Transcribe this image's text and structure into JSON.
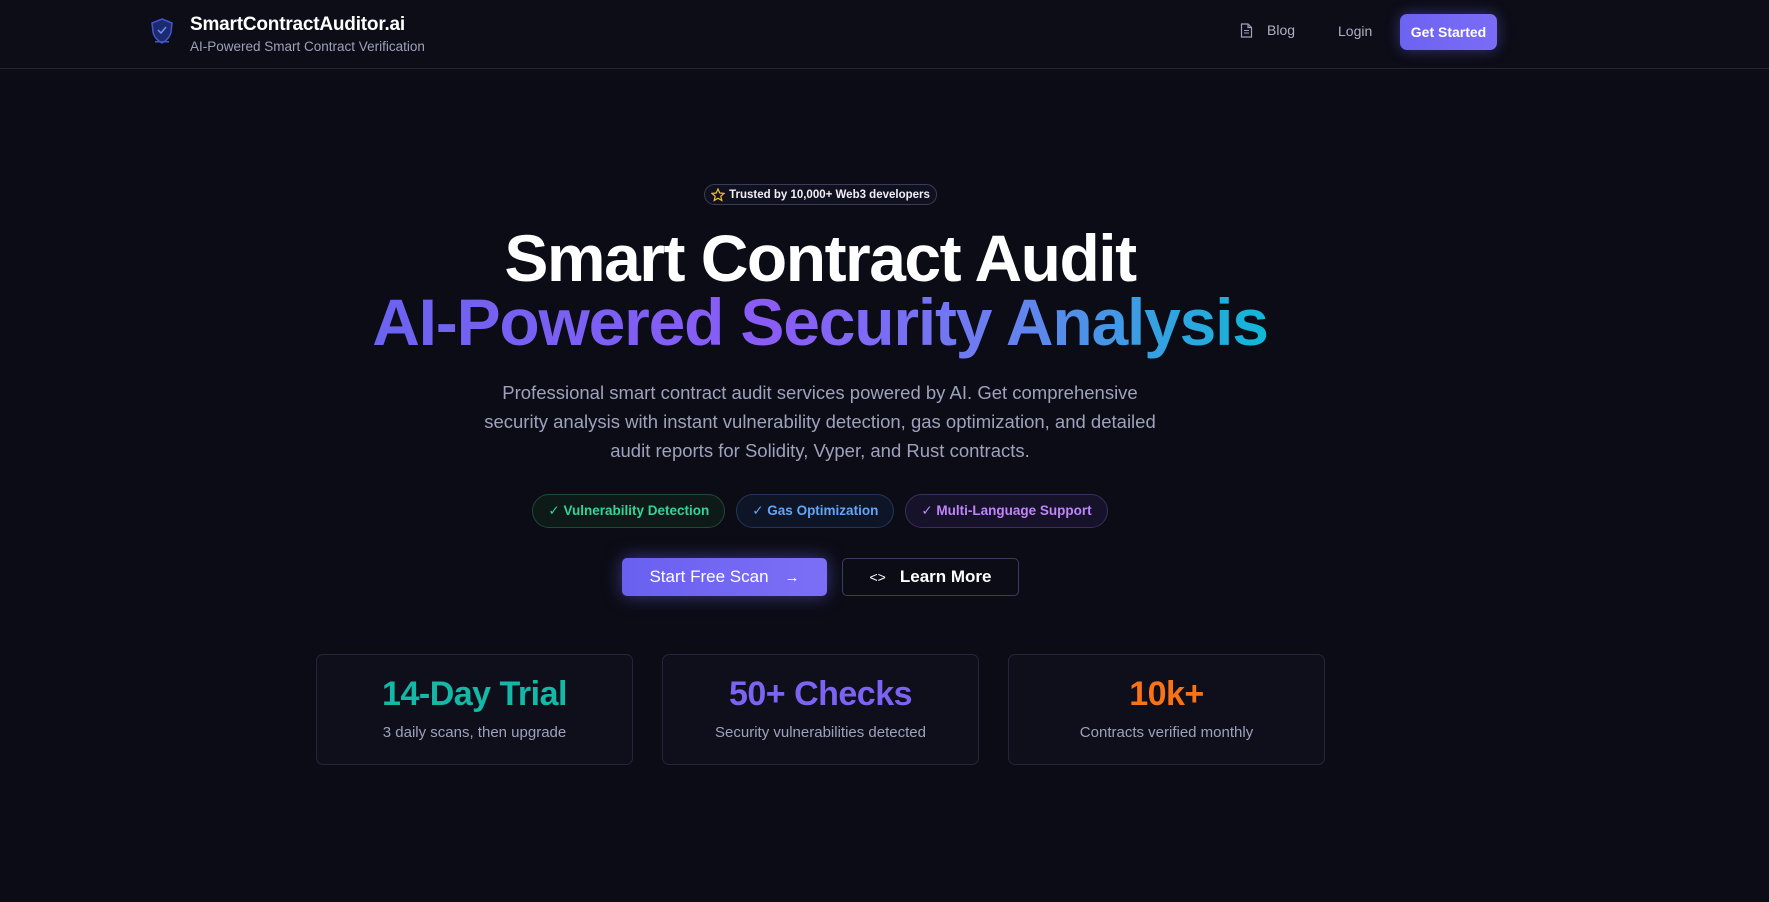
{
  "header": {
    "brand_title": "SmartContractAuditor.ai",
    "brand_subtitle": "AI-Powered Smart Contract Verification",
    "nav_blog": "Blog",
    "nav_login": "Login",
    "nav_cta": "Get Started"
  },
  "hero": {
    "badge": "Trusted by 10,000+ Web3 developers",
    "title_line1": "Smart Contract Audit",
    "title_line2": "AI-Powered Security Analysis",
    "description": "Professional smart contract audit services powered by AI. Get comprehensive security analysis with instant vulnerability detection, gas optimization, and detailed audit reports for Solidity, Vyper, and Rust contracts.",
    "features": [
      "✓ Vulnerability Detection",
      "✓ Gas Optimization",
      "✓ Multi-Language Support"
    ],
    "primary_button": "Start Free Scan",
    "secondary_button": "Learn More"
  },
  "stats": [
    {
      "value": "14-Day Trial",
      "label": "3 daily scans, then upgrade",
      "color": "#14b8a6"
    },
    {
      "value": "50+ Checks",
      "label": "Security vulnerabilities detected",
      "color": "#7c63f2"
    },
    {
      "value": "10k+",
      "label": "Contracts verified monthly",
      "color": "#f97316"
    }
  ],
  "colors": {
    "background": "#0b0c15",
    "accent": "#6d63f2"
  },
  "icons": {
    "logo": "shield-logo-icon",
    "blog": "document-icon",
    "badge": "star-icon",
    "primary_button": "arrow-right-icon",
    "secondary_button": "code-icon"
  }
}
